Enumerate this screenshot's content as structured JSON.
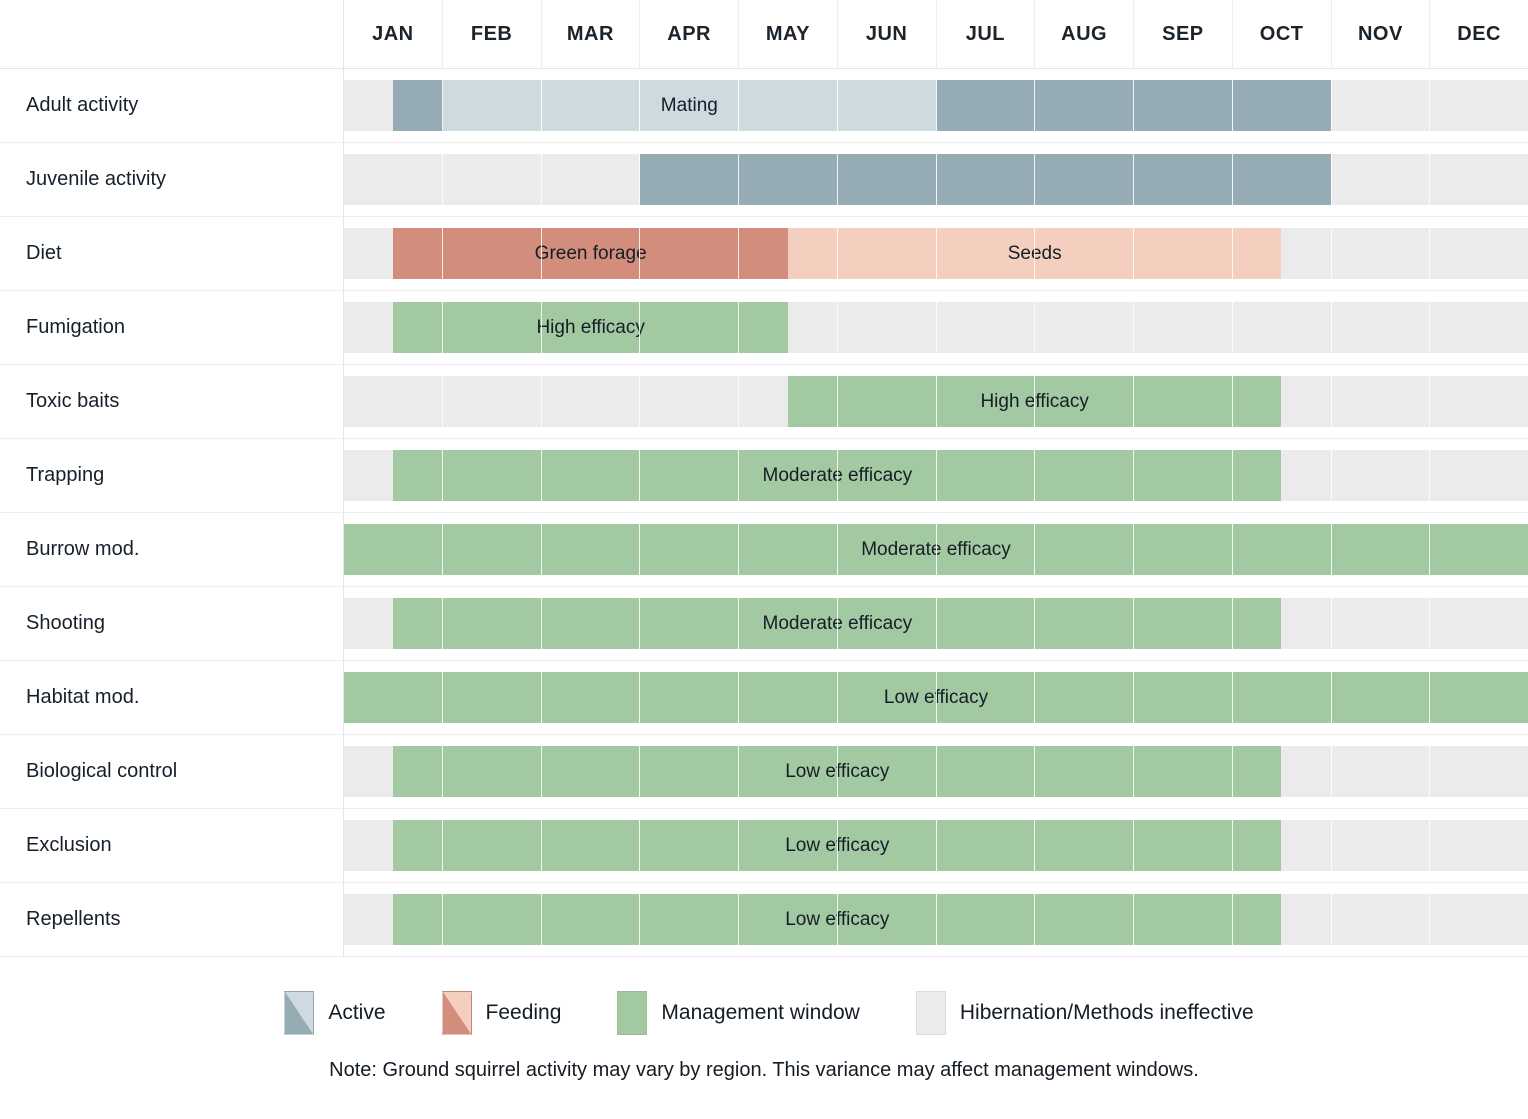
{
  "months": [
    "JAN",
    "FEB",
    "MAR",
    "APR",
    "MAY",
    "JUN",
    "JUL",
    "AUG",
    "SEP",
    "OCT",
    "NOV",
    "DEC"
  ],
  "colors": {
    "active_dark": "#96acb5",
    "active_light": "#ced9e0",
    "feeding_dark": "#d28d7c",
    "feeding_light": "#f4cfbf",
    "management": "#a3c9a2",
    "inactive": "#ebebeb",
    "grid": "#e3e5e7",
    "text": "#16202b"
  },
  "rows": [
    {
      "label": "Adult activity",
      "bars": [
        {
          "text": "",
          "start": 0.5,
          "end": 1.0,
          "color": "#96acb5"
        },
        {
          "text": "Mating",
          "start": 1.0,
          "end": 6.0,
          "color": "#ced9e0"
        },
        {
          "text": "",
          "start": 6.0,
          "end": 10.0,
          "color": "#96acb5"
        }
      ]
    },
    {
      "label": "Juvenile activity",
      "bars": [
        {
          "text": "",
          "start": 3.0,
          "end": 10.0,
          "color": "#96acb5"
        }
      ]
    },
    {
      "label": "Diet",
      "bars": [
        {
          "text": "Green forage",
          "start": 0.5,
          "end": 4.5,
          "color": "#d28d7c"
        },
        {
          "text": "Seeds",
          "start": 4.5,
          "end": 9.5,
          "color": "#f4cfbf"
        }
      ]
    },
    {
      "label": "Fumigation",
      "bars": [
        {
          "text": "High efficacy",
          "start": 0.5,
          "end": 4.5,
          "color": "#a3c9a2"
        }
      ]
    },
    {
      "label": "Toxic baits",
      "bars": [
        {
          "text": "High efficacy",
          "start": 4.5,
          "end": 9.5,
          "color": "#a3c9a2"
        }
      ]
    },
    {
      "label": "Trapping",
      "bars": [
        {
          "text": "Moderate efficacy",
          "start": 0.5,
          "end": 9.5,
          "color": "#a3c9a2"
        }
      ]
    },
    {
      "label": "Burrow mod.",
      "bars": [
        {
          "text": "Moderate efficacy",
          "start": 0.0,
          "end": 12.0,
          "color": "#a3c9a2"
        }
      ]
    },
    {
      "label": "Shooting",
      "bars": [
        {
          "text": "Moderate efficacy",
          "start": 0.5,
          "end": 9.5,
          "color": "#a3c9a2"
        }
      ]
    },
    {
      "label": "Habitat mod.",
      "bars": [
        {
          "text": "Low efficacy",
          "start": 0.0,
          "end": 12.0,
          "color": "#a3c9a2"
        }
      ]
    },
    {
      "label": "Biological control",
      "bars": [
        {
          "text": "Low efficacy",
          "start": 0.5,
          "end": 9.5,
          "color": "#a3c9a2"
        }
      ]
    },
    {
      "label": "Exclusion",
      "bars": [
        {
          "text": "Low efficacy",
          "start": 0.5,
          "end": 9.5,
          "color": "#a3c9a2"
        }
      ]
    },
    {
      "label": "Repellents",
      "bars": [
        {
          "text": "Low efficacy",
          "start": 0.5,
          "end": 9.5,
          "color": "#a3c9a2"
        }
      ]
    }
  ],
  "legend": [
    {
      "label": "Active",
      "style": "split",
      "color_a": "#96acb5",
      "color_b": "#ced9e0"
    },
    {
      "label": "Feeding",
      "style": "split",
      "color_a": "#d28d7c",
      "color_b": "#f4cfbf"
    },
    {
      "label": "Management window",
      "style": "solid",
      "color_a": "#a3c9a2",
      "color_b": "#a3c9a2"
    },
    {
      "label": "Hibernation/Methods ineffective",
      "style": "empty",
      "color_a": "#ebebeb",
      "color_b": "#ebebeb"
    }
  ],
  "note": "Note: Ground squirrel activity may vary by region. This variance may affect management windows.",
  "chart_data": {
    "type": "table",
    "title": "",
    "xlabel": "",
    "ylabel": "",
    "x_categories": [
      "JAN",
      "FEB",
      "MAR",
      "APR",
      "MAY",
      "JUN",
      "JUL",
      "AUG",
      "SEP",
      "OCT",
      "NOV",
      "DEC"
    ],
    "xlim": [
      0,
      12
    ],
    "grid": true,
    "legend_position": "bottom",
    "series": [
      {
        "name": "Adult activity",
        "segments": [
          {
            "label": "",
            "start_month": 0.5,
            "end_month": 1.0,
            "category": "Active"
          },
          {
            "label": "Mating",
            "start_month": 1.0,
            "end_month": 6.0,
            "category": "Active (light)"
          },
          {
            "label": "",
            "start_month": 6.0,
            "end_month": 10.0,
            "category": "Active"
          }
        ]
      },
      {
        "name": "Juvenile activity",
        "segments": [
          {
            "label": "",
            "start_month": 3.0,
            "end_month": 10.0,
            "category": "Active"
          }
        ]
      },
      {
        "name": "Diet",
        "segments": [
          {
            "label": "Green forage",
            "start_month": 0.5,
            "end_month": 4.5,
            "category": "Feeding"
          },
          {
            "label": "Seeds",
            "start_month": 4.5,
            "end_month": 9.5,
            "category": "Feeding (light)"
          }
        ]
      },
      {
        "name": "Fumigation",
        "segments": [
          {
            "label": "High efficacy",
            "start_month": 0.5,
            "end_month": 4.5,
            "category": "Management window"
          }
        ]
      },
      {
        "name": "Toxic baits",
        "segments": [
          {
            "label": "High efficacy",
            "start_month": 4.5,
            "end_month": 9.5,
            "category": "Management window"
          }
        ]
      },
      {
        "name": "Trapping",
        "segments": [
          {
            "label": "Moderate efficacy",
            "start_month": 0.5,
            "end_month": 9.5,
            "category": "Management window"
          }
        ]
      },
      {
        "name": "Burrow mod.",
        "segments": [
          {
            "label": "Moderate efficacy",
            "start_month": 0.0,
            "end_month": 12.0,
            "category": "Management window"
          }
        ]
      },
      {
        "name": "Shooting",
        "segments": [
          {
            "label": "Moderate efficacy",
            "start_month": 0.5,
            "end_month": 9.5,
            "category": "Management window"
          }
        ]
      },
      {
        "name": "Habitat mod.",
        "segments": [
          {
            "label": "Low efficacy",
            "start_month": 0.0,
            "end_month": 12.0,
            "category": "Management window"
          }
        ]
      },
      {
        "name": "Biological control",
        "segments": [
          {
            "label": "Low efficacy",
            "start_month": 0.5,
            "end_month": 9.5,
            "category": "Management window"
          }
        ]
      },
      {
        "name": "Exclusion",
        "segments": [
          {
            "label": "Low efficacy",
            "start_month": 0.5,
            "end_month": 9.5,
            "category": "Management window"
          }
        ]
      },
      {
        "name": "Repellents",
        "segments": [
          {
            "label": "Low efficacy",
            "start_month": 0.5,
            "end_month": 9.5,
            "category": "Management window"
          }
        ]
      }
    ],
    "legend_entries": [
      "Active",
      "Feeding",
      "Management window",
      "Hibernation/Methods ineffective"
    ],
    "annotations": [
      "Note: Ground squirrel activity may vary by region. This variance may affect management windows."
    ]
  }
}
